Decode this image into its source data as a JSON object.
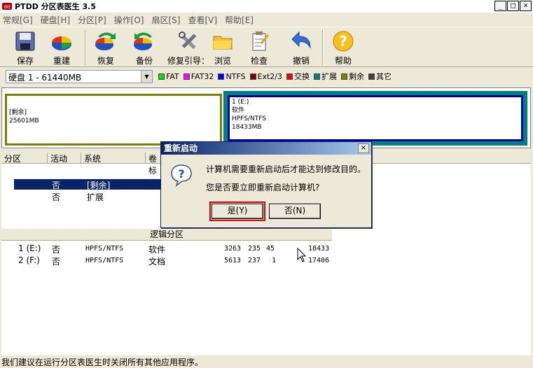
{
  "titlebar": {
    "title": "PTDD 分区表医生 3.5",
    "min": "_",
    "max": "□",
    "close": "×"
  },
  "menu": [
    "常规[G]",
    "硬盘[H]",
    "分区[P]",
    "操作[O]",
    "扇区[S]",
    "查看[V]",
    "帮助[E]"
  ],
  "toolbar": {
    "save": "保存",
    "rebuild": "重建",
    "restore": "恢复",
    "backup": "备份",
    "repair_boot": "修复引导：",
    "browse": "浏览",
    "check": "检查",
    "undo": "撤销",
    "help": "帮助"
  },
  "disk_select": "硬盘 1 - 61440MB",
  "legend": [
    {
      "label": "FAT",
      "color": "#00e000"
    },
    {
      "label": "FAT32",
      "color": "#ff00ff"
    },
    {
      "label": "NTFS",
      "color": "#0000ff"
    },
    {
      "label": "Ext2/3",
      "color": "#800000"
    },
    {
      "label": "交换",
      "color": "#ff0000"
    },
    {
      "label": "扩展",
      "color": "#008080"
    },
    {
      "label": "剩余",
      "color": "#808000"
    },
    {
      "label": "其它",
      "color": "#404040"
    }
  ],
  "diskmap": {
    "free_label": "[剩余]",
    "free_size": "25601MB",
    "ntfs_label": "1 (E:)",
    "ntfs_name": "软件",
    "ntfs_fs": "HPFS/NTFS",
    "ntfs_size": "18433MB"
  },
  "list_headers": [
    "分区",
    "活动",
    "系统",
    "卷标"
  ],
  "primary_rows": [
    {
      "active": "否",
      "system": "[剩余]"
    },
    {
      "active": "否",
      "system": "扩展"
    }
  ],
  "group_label": "逻辑分区",
  "logical_rows": [
    {
      "id": "1 (E:)",
      "active": "否",
      "system": "HPFS/NTFS",
      "label": "软件",
      "c1": "3263",
      "c2": "235",
      "c3": "45",
      "size": "18433"
    },
    {
      "id": "2 (F:)",
      "active": "否",
      "system": "HPFS/NTFS",
      "label": "文档",
      "c1": "5613",
      "c2": "237",
      "c3": "1",
      "size": "17406"
    }
  ],
  "status": "我们建议在运行分区表医生时关闭所有其他应用程序。",
  "dialog": {
    "title": "重新启动",
    "close": "×",
    "line1": "计算机需要重新启动后才能达到修改目的。",
    "line2": "您是否要立即重新启动计算机?",
    "yes": "是(Y)",
    "no": "否(N)"
  }
}
